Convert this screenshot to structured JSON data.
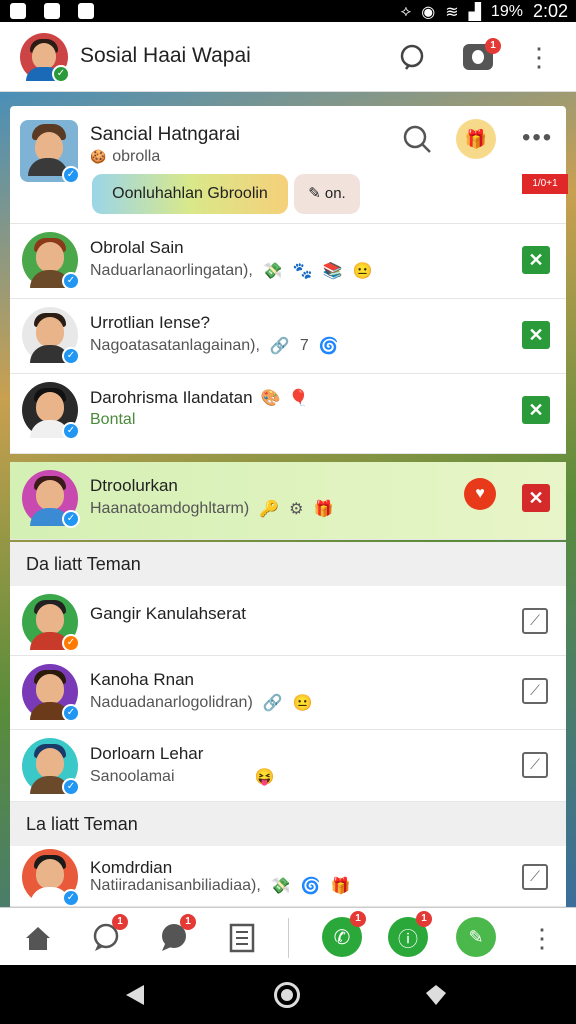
{
  "status_bar": {
    "battery": "19%",
    "time": "2:02"
  },
  "app_bar": {
    "title": "Sosial Haai Wapai",
    "notification_count": "1"
  },
  "profile_card": {
    "name": "Sancial Hatngarai",
    "status": "obrolla",
    "pill_primary": "Oonluhahlan Gbroolin",
    "pill_secondary": "on.",
    "tag": "1/0+1"
  },
  "chats": [
    {
      "name": "Obrolal Sain",
      "message": "Naduarlanaorlingatan),",
      "action": "remove",
      "emojis": [
        "💸",
        "🐾",
        "📚",
        "😐"
      ]
    },
    {
      "name": "Urrotlian Iense?",
      "message": "Nagoatasatanlagainan),",
      "action": "remove",
      "emojis": [
        "🔗",
        "7",
        "🌀"
      ]
    },
    {
      "name": "Darohrisma Ilandatan",
      "message": "Bontal",
      "action": "remove",
      "emojis": [
        "🎨",
        "🎈"
      ]
    },
    {
      "name": "Dtroolurkan",
      "message": "Haanatoamdoghltarm)",
      "action": "remove",
      "emojis": [
        "🔑",
        "⚙",
        "🎁"
      ]
    }
  ],
  "sections": [
    {
      "title": "Da liatt Teman",
      "items": [
        {
          "name": "Gangir Kanulahserat",
          "message": "",
          "emojis": []
        },
        {
          "name": "Kanoha Rnan",
          "message": "Naduadanarlogolidran)",
          "emojis": [
            "🔗",
            "😐"
          ]
        },
        {
          "name": "Dorloarn Lehar",
          "message": "Sanoolamai",
          "emojis": [
            "😝"
          ]
        }
      ]
    },
    {
      "title": "La liatt Teman",
      "items": [
        {
          "name": "Komdrdian",
          "message": "Natiiradanisanbiliadiaa),",
          "emojis": [
            "💸",
            "🌀",
            "🎁"
          ]
        }
      ]
    }
  ],
  "bottom_nav": {
    "chat_badge": "1",
    "messages_badge": "1",
    "whatsapp_badge": "1",
    "call_badge": "1"
  },
  "colors": {
    "accent_green": "#2a9a3a",
    "accent_red": "#d42a2a",
    "highlight": "#d4f0b4"
  }
}
